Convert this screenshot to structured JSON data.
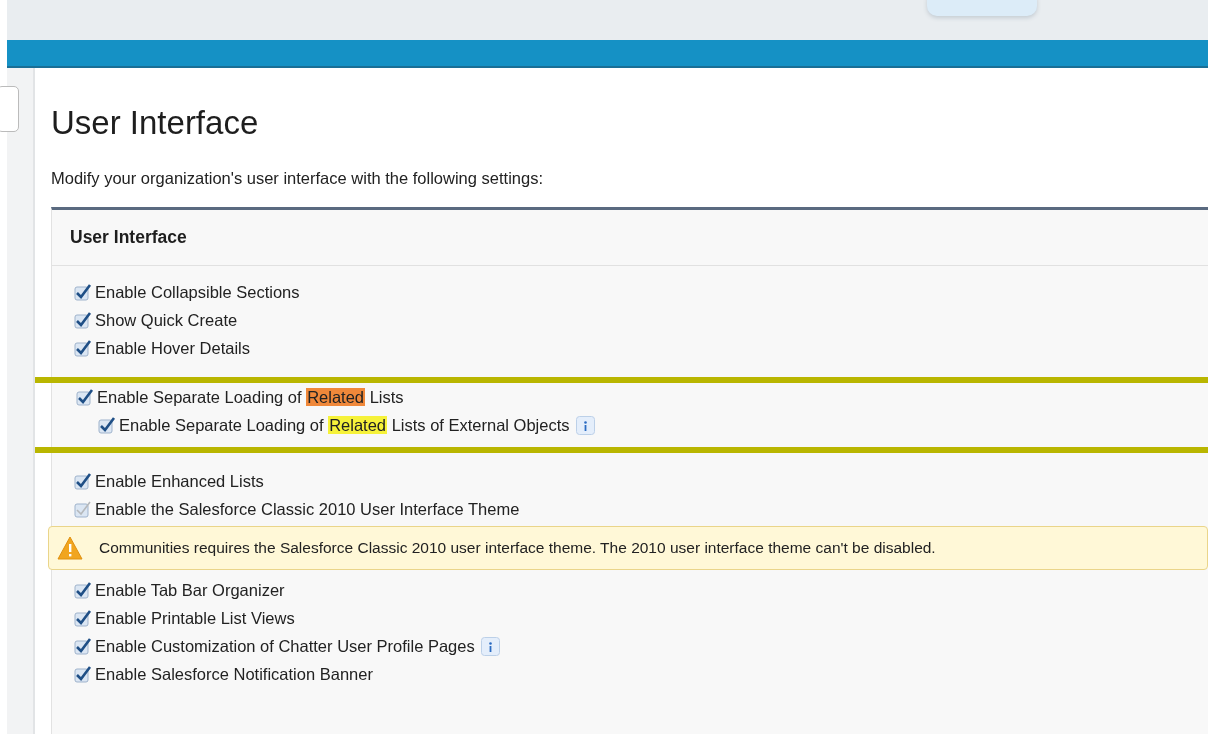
{
  "page": {
    "title": "User Interface",
    "description": "Modify your organization's user interface with the following settings:"
  },
  "section": {
    "title": "User Interface",
    "items": [
      {
        "kind": "checkbox",
        "checked": true,
        "disabled": false,
        "parts": [
          {
            "text": "Enable Collapsible Sections"
          }
        ]
      },
      {
        "kind": "checkbox",
        "checked": true,
        "disabled": false,
        "parts": [
          {
            "text": "Show Quick Create"
          }
        ]
      },
      {
        "kind": "checkbox",
        "checked": true,
        "disabled": false,
        "parts": [
          {
            "text": "Enable Hover Details"
          }
        ]
      },
      {
        "kind": "highlight",
        "children": [
          {
            "kind": "checkbox",
            "checked": true,
            "disabled": false,
            "parts": [
              {
                "text": "Enable Separate Loading of "
              },
              {
                "text": "Related",
                "color": "#f0883a"
              },
              {
                "text": " Lists"
              }
            ]
          },
          {
            "kind": "checkbox",
            "checked": true,
            "disabled": false,
            "info": true,
            "indented": true,
            "parts": [
              {
                "text": "Enable Separate Loading of "
              },
              {
                "text": "Related",
                "color": "#f6f23a"
              },
              {
                "text": " Lists of External Objects"
              }
            ]
          }
        ]
      },
      {
        "kind": "checkbox",
        "checked": true,
        "disabled": false,
        "parts": [
          {
            "text": "Enable Enhanced Lists"
          }
        ]
      },
      {
        "kind": "checkbox",
        "checked": true,
        "disabled": true,
        "parts": [
          {
            "text": "Enable the Salesforce Classic 2010 User Interface Theme"
          }
        ]
      },
      {
        "kind": "warning",
        "text": "Communities requires the Salesforce Classic 2010 user interface theme. The 2010 user interface theme can't be disabled."
      },
      {
        "kind": "checkbox",
        "checked": true,
        "disabled": false,
        "parts": [
          {
            "text": "Enable Tab Bar Organizer"
          }
        ]
      },
      {
        "kind": "checkbox",
        "checked": true,
        "disabled": false,
        "parts": [
          {
            "text": "Enable Printable List Views"
          }
        ]
      },
      {
        "kind": "checkbox",
        "checked": true,
        "disabled": false,
        "info": true,
        "parts": [
          {
            "text": "Enable Customization of Chatter User Profile Pages"
          }
        ]
      },
      {
        "kind": "checkbox",
        "checked": true,
        "disabled": false,
        "parts": [
          {
            "text": "Enable Salesforce Notification Banner"
          }
        ]
      }
    ]
  }
}
